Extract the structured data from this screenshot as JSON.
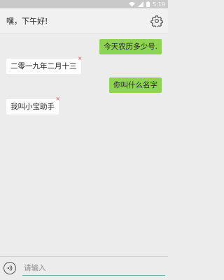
{
  "status_bar": {
    "time": "5:19"
  },
  "header": {
    "title": "嘿，下午好!"
  },
  "messages": [
    {
      "sender": "user",
      "text": "今天农历多少号."
    },
    {
      "sender": "bot",
      "text": "二零一九年二月十三"
    },
    {
      "sender": "user",
      "text": "你叫什么名字"
    },
    {
      "sender": "bot",
      "text": "我叫小宝助手"
    }
  ],
  "input": {
    "placeholder": "请输入",
    "value": ""
  },
  "icons": {
    "settings": "gear-icon",
    "voice": "voice-icon",
    "wifi": "wifi-icon",
    "signal": "signal-icon",
    "battery": "battery-icon",
    "bubble_close": "close-icon"
  },
  "colors": {
    "user_bubble": "#8ed351",
    "bot_bubble": "#ffffff",
    "close_mark": "#f04848"
  },
  "bubble_close_glyph": "×"
}
